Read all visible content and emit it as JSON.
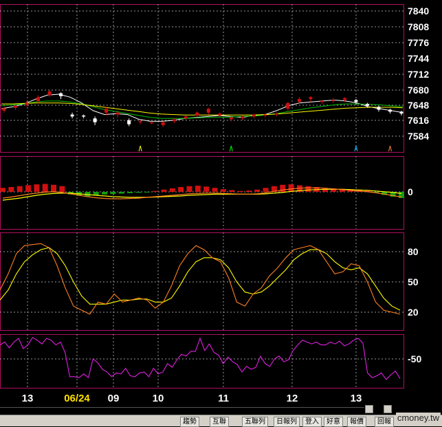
{
  "chart_data": [
    {
      "pane": "price",
      "type": "candlestick",
      "y_ticks": [
        7840,
        7808,
        7776,
        7744,
        7712,
        7680,
        7648,
        7616,
        7584
      ],
      "ylim": [
        7570,
        7845
      ],
      "ma_series": [
        {
          "color": "#ffffff",
          "values": [
            7640,
            7644,
            7650,
            7660,
            7668,
            7670,
            7664,
            7652,
            7636,
            7628,
            7630,
            7628,
            7618,
            7614,
            7614,
            7616,
            7620,
            7622,
            7624,
            7626,
            7624,
            7622,
            7626,
            7628,
            7636,
            7646,
            7652,
            7654,
            7656,
            7658,
            7656,
            7652,
            7644,
            7640,
            7636,
            7632
          ]
        },
        {
          "color": "#00c000",
          "values": [
            7646,
            7648,
            7650,
            7654,
            7656,
            7656,
            7654,
            7650,
            7644,
            7638,
            7634,
            7630,
            7626,
            7622,
            7620,
            7620,
            7620,
            7621,
            7622,
            7622,
            7623,
            7624,
            7625,
            7627,
            7630,
            7634,
            7638,
            7642,
            7645,
            7648,
            7650,
            7650,
            7649,
            7648,
            7646,
            7644
          ]
        },
        {
          "color": "#ffff00",
          "values": [
            7650,
            7650,
            7651,
            7652,
            7652,
            7652,
            7651,
            7649,
            7646,
            7643,
            7640,
            7637,
            7634,
            7631,
            7629,
            7628,
            7627,
            7627,
            7627,
            7627,
            7627,
            7627,
            7627,
            7628,
            7629,
            7631,
            7633,
            7635,
            7637,
            7639,
            7641,
            7642,
            7643,
            7643,
            7643,
            7642
          ]
        }
      ],
      "candles": [
        {
          "o": 7636,
          "c": 7641,
          "h": 7644,
          "l": 7632
        },
        {
          "o": 7642,
          "c": 7646,
          "h": 7648,
          "l": 7638
        },
        {
          "o": 7648,
          "c": 7652,
          "h": 7656,
          "l": 7644
        },
        {
          "o": 7656,
          "c": 7664,
          "h": 7668,
          "l": 7652
        },
        {
          "o": 7668,
          "c": 7676,
          "h": 7678,
          "l": 7664
        },
        {
          "o": 7672,
          "c": 7666,
          "h": 7674,
          "l": 7660
        },
        {
          "o": 7628,
          "c": 7624,
          "h": 7632,
          "l": 7620
        },
        {
          "o": 7626,
          "c": 7624,
          "h": 7628,
          "l": 7620
        },
        {
          "o": 7620,
          "c": 7612,
          "h": 7624,
          "l": 7606
        },
        {
          "o": 7632,
          "c": 7640,
          "h": 7644,
          "l": 7626
        },
        {
          "o": 7628,
          "c": 7632,
          "h": 7636,
          "l": 7622
        },
        {
          "o": 7616,
          "c": 7608,
          "h": 7620,
          "l": 7604
        },
        {
          "o": 7612,
          "c": 7614,
          "h": 7616,
          "l": 7608
        },
        {
          "o": 7612,
          "c": 7612,
          "h": 7614,
          "l": 7608
        },
        {
          "o": 7606,
          "c": 7612,
          "h": 7614,
          "l": 7602
        },
        {
          "o": 7614,
          "c": 7618,
          "h": 7620,
          "l": 7610
        },
        {
          "o": 7620,
          "c": 7624,
          "h": 7626,
          "l": 7616
        },
        {
          "o": 7626,
          "c": 7632,
          "h": 7634,
          "l": 7622
        },
        {
          "o": 7632,
          "c": 7640,
          "h": 7642,
          "l": 7628
        },
        {
          "o": 7626,
          "c": 7630,
          "h": 7632,
          "l": 7622
        },
        {
          "o": 7618,
          "c": 7622,
          "h": 7624,
          "l": 7614
        },
        {
          "o": 7620,
          "c": 7624,
          "h": 7626,
          "l": 7616
        },
        {
          "o": 7624,
          "c": 7628,
          "h": 7630,
          "l": 7620
        },
        {
          "o": 7626,
          "c": 7628,
          "h": 7630,
          "l": 7622
        },
        {
          "o": 7628,
          "c": 7630,
          "h": 7632,
          "l": 7624
        },
        {
          "o": 7640,
          "c": 7652,
          "h": 7654,
          "l": 7636
        },
        {
          "o": 7654,
          "c": 7660,
          "h": 7664,
          "l": 7650
        },
        {
          "o": 7660,
          "c": 7664,
          "h": 7666,
          "l": 7654
        },
        {
          "o": 7654,
          "c": 7656,
          "h": 7658,
          "l": 7650
        },
        {
          "o": 7656,
          "c": 7658,
          "h": 7662,
          "l": 7652
        },
        {
          "o": 7658,
          "c": 7662,
          "h": 7664,
          "l": 7654
        },
        {
          "o": 7658,
          "c": 7654,
          "h": 7660,
          "l": 7650
        },
        {
          "o": 7650,
          "c": 7646,
          "h": 7652,
          "l": 7642
        },
        {
          "o": 7644,
          "c": 7638,
          "h": 7646,
          "l": 7634
        },
        {
          "o": 7638,
          "c": 7634,
          "h": 7640,
          "l": 7630
        },
        {
          "o": 7634,
          "c": 7630,
          "h": 7636,
          "l": 7626
        }
      ],
      "markers": [
        {
          "i": 12,
          "color": "#ffff00"
        },
        {
          "i": 20,
          "color": "#00ff00"
        },
        {
          "i": 31,
          "color": "#00c0ff"
        },
        {
          "i": 34,
          "color": "#ff8040"
        }
      ]
    },
    {
      "pane": "macd",
      "type": "bar+line",
      "y_ticks": [
        0
      ],
      "ylim": [
        -10,
        10
      ],
      "histogram": [
        1.8,
        2.2,
        2.6,
        3.0,
        3.4,
        3.6,
        3.2,
        2.6,
        -1.2,
        -1.8,
        -2.0,
        -1.6,
        -1.2,
        -1.0,
        -0.8,
        -0.6,
        -0.4,
        -0.2,
        0.4,
        1.0,
        1.6,
        2.2,
        2.6,
        2.8,
        2.4,
        1.8,
        1.2,
        0.8,
        0.4,
        0.6,
        1.0,
        1.8,
        2.6,
        3.2,
        3.4,
        3.0,
        2.6,
        2.2,
        1.8,
        1.6,
        1.4,
        1.2,
        1.0,
        0.8,
        -0.4,
        -1.4,
        -2.2,
        -2.8
      ],
      "dif": [
        -0.6,
        -0.3,
        0.1,
        0.5,
        0.8,
        1.1,
        1.2,
        1.0,
        0.6,
        0.2,
        -0.2,
        -0.5,
        -0.7,
        -0.8,
        -0.8,
        -0.7,
        -0.6,
        -0.4,
        -0.2,
        0.0,
        0.2,
        0.4,
        0.6,
        0.7,
        0.8,
        0.8,
        0.7,
        0.6,
        0.5,
        0.5,
        0.6,
        0.9,
        1.3,
        1.7,
        2.0,
        2.2,
        2.3,
        2.3,
        2.2,
        2.0,
        1.8,
        1.6,
        1.4,
        1.2,
        0.9,
        0.5,
        0.1,
        -0.3
      ],
      "macd": [
        -1.2,
        -0.9,
        -0.6,
        -0.2,
        0.2,
        0.5,
        0.7,
        0.8,
        0.8,
        0.6,
        0.4,
        0.2,
        0.0,
        -0.2,
        -0.3,
        -0.4,
        -0.4,
        -0.4,
        -0.3,
        -0.2,
        -0.1,
        0.0,
        0.2,
        0.3,
        0.4,
        0.5,
        0.5,
        0.5,
        0.5,
        0.5,
        0.5,
        0.6,
        0.8,
        1.0,
        1.3,
        1.5,
        1.7,
        1.8,
        1.9,
        1.9,
        1.9,
        1.8,
        1.7,
        1.6,
        1.4,
        1.2,
        1.0,
        0.7
      ]
    },
    {
      "pane": "kd",
      "type": "line",
      "y_ticks": [
        80,
        50,
        20
      ],
      "ylim": [
        0,
        100
      ],
      "k_color": "#ff8020",
      "d_color": "#ffff00",
      "k": [
        42,
        58,
        78,
        86,
        87,
        88,
        84,
        66,
        44,
        26,
        22,
        18,
        30,
        28,
        38,
        30,
        32,
        34,
        32,
        24,
        30,
        46,
        66,
        78,
        86,
        82,
        74,
        70,
        54,
        30,
        26,
        38,
        44,
        56,
        64,
        74,
        82,
        84,
        86,
        82,
        70,
        58,
        60,
        68,
        66,
        50,
        30,
        22,
        20,
        18
      ],
      "d": [
        32,
        42,
        58,
        70,
        77,
        82,
        84,
        78,
        66,
        50,
        36,
        28,
        28,
        28,
        30,
        32,
        32,
        33,
        33,
        30,
        30,
        34,
        46,
        60,
        70,
        74,
        74,
        72,
        64,
        50,
        40,
        38,
        40,
        46,
        54,
        62,
        72,
        78,
        82,
        82,
        78,
        70,
        64,
        62,
        64,
        58,
        46,
        34,
        26,
        22
      ]
    },
    {
      "pane": "indicator",
      "type": "line",
      "y_ticks": [
        -50
      ],
      "ylim": [
        -110,
        10
      ],
      "color": "#e020e0",
      "values": [
        -20,
        -14,
        -26,
        -14,
        -6,
        -28,
        -20,
        -4,
        -10,
        -18,
        -6,
        -10,
        -20,
        -14,
        -36,
        -88,
        -88,
        -90,
        -82,
        -90,
        -50,
        -58,
        -72,
        -78,
        -88,
        -80,
        -82,
        -70,
        -86,
        -88,
        -80,
        -78,
        -88,
        -70,
        -82,
        -78,
        -60,
        -68,
        -52,
        -40,
        -44,
        -34,
        -34,
        -6,
        -32,
        -18,
        -36,
        -42,
        -60,
        -46,
        -56,
        -62,
        -78,
        -66,
        -72,
        -68,
        -44,
        -60,
        -66,
        -50,
        -44,
        -56,
        -52,
        -32,
        -20,
        -10,
        -14,
        -18,
        -14,
        -20,
        -20,
        -14,
        -18,
        -12,
        -22,
        -18,
        -10,
        -6,
        -16,
        -80,
        -90,
        -86,
        -80,
        -94,
        -84,
        -76,
        -92
      ]
    }
  ],
  "x_ticks": [
    {
      "label": "13",
      "highlight": false
    },
    {
      "label": "06/24",
      "highlight": true
    },
    {
      "label": "09",
      "highlight": false
    },
    {
      "label": "10",
      "highlight": false
    },
    {
      "label": "11",
      "highlight": false
    },
    {
      "label": "12",
      "highlight": false
    },
    {
      "label": "13",
      "highlight": false
    }
  ],
  "bottom_tabs": [
    "趨勢",
    "互聯",
    "五聯列",
    "日報列",
    "登入",
    "好意",
    "報價",
    "回報"
  ],
  "watermark": "cmoney.tw",
  "colors": {
    "up": "#d01010",
    "down": "#ffffff",
    "hist_up": "#d01010",
    "hist_down": "#10a010",
    "border": "#b01060",
    "grid": "#9a9a9a"
  }
}
